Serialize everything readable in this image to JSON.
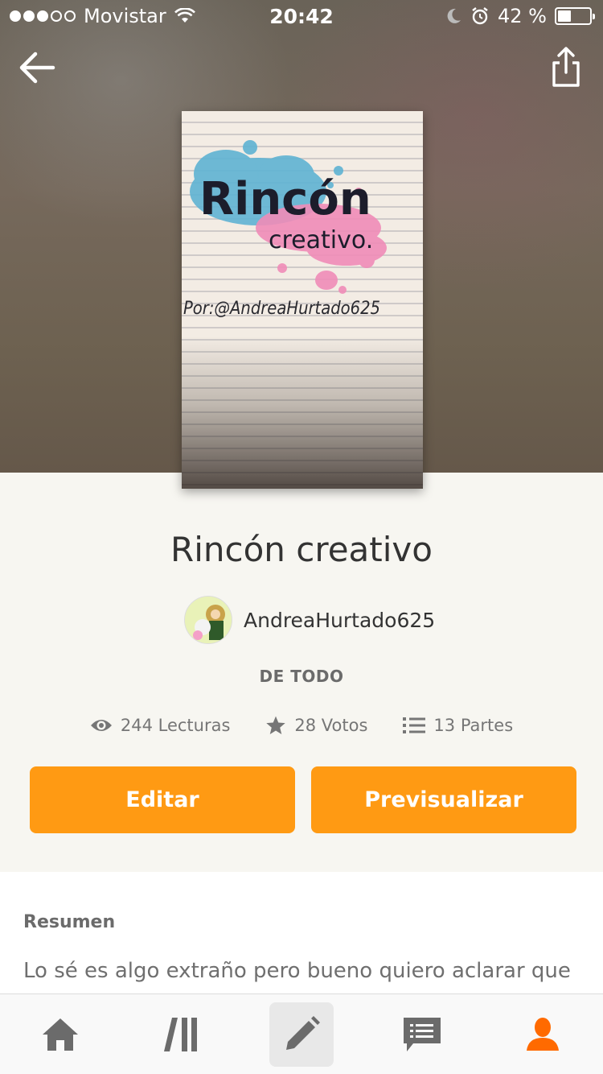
{
  "status_bar": {
    "carrier": "Movistar",
    "time": "20:42",
    "battery": "42 %",
    "battery_level": 0.42,
    "signal_bars_filled": 3,
    "signal_bars_total": 5
  },
  "header": {
    "back_icon": "arrow-left-icon",
    "share_icon": "share-icon"
  },
  "cover": {
    "title_line1": "Rincón",
    "title_line2": "creativo.",
    "byline": "Por:@AndreaHurtado625",
    "splash_colors": [
      "#5fb3d3",
      "#f08cb8"
    ]
  },
  "story": {
    "title": "Rincón creativo",
    "author": "AndreaHurtado625",
    "category": "DE TODO"
  },
  "stats": {
    "reads": "244 Lecturas",
    "votes": "28 Votos",
    "parts": "13 Partes"
  },
  "actions": {
    "edit_label": "Editar",
    "preview_label": "Previsualizar",
    "accent_color": "#ff9a13"
  },
  "summary": {
    "heading": "Resumen",
    "text": "Lo sé es algo extraño pero bueno quiero aclarar que"
  },
  "bottom_nav": {
    "items": [
      "home-icon",
      "library-icon",
      "write-icon",
      "messages-icon",
      "profile-icon"
    ],
    "active": "write-icon",
    "profile_color": "#ff6a00"
  }
}
